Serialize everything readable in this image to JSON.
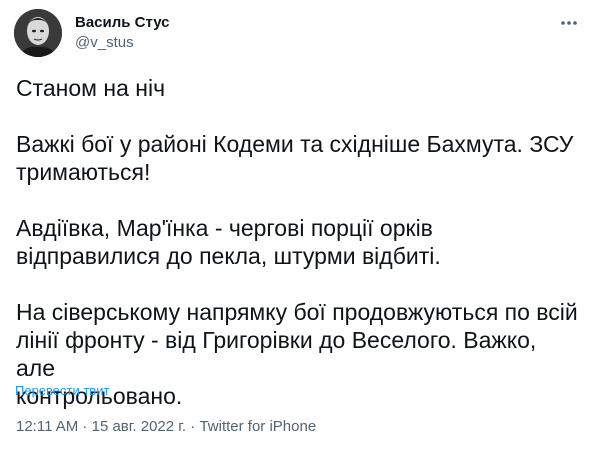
{
  "author": {
    "display_name": "Василь Стус",
    "handle": "@v_stus"
  },
  "more_icon": "more-horizontal-icon",
  "tweet": {
    "paragraphs": [
      "Станом на ніч",
      "Важкі бої у районі Кодеми та східніше Бахмута. ЗСУ\nтримаються!",
      "Авдіївка, Мар'їнка - чергові порції орків\nвідправилися до пекла, штурми відбиті.",
      "На сіверському напрямку бої продовжуються по всій\nлінії фронту - від Григорівки до Веселого. Важко, але\nконтрольовано."
    ]
  },
  "translate_label": "Перевести твит",
  "meta": {
    "time": "12:11 AM",
    "separator": " · ",
    "date": "15 авг. 2022 г.",
    "source": "Twitter for iPhone"
  },
  "colors": {
    "text": "#0f1419",
    "secondary": "#536471",
    "link": "#1d9bf0"
  }
}
